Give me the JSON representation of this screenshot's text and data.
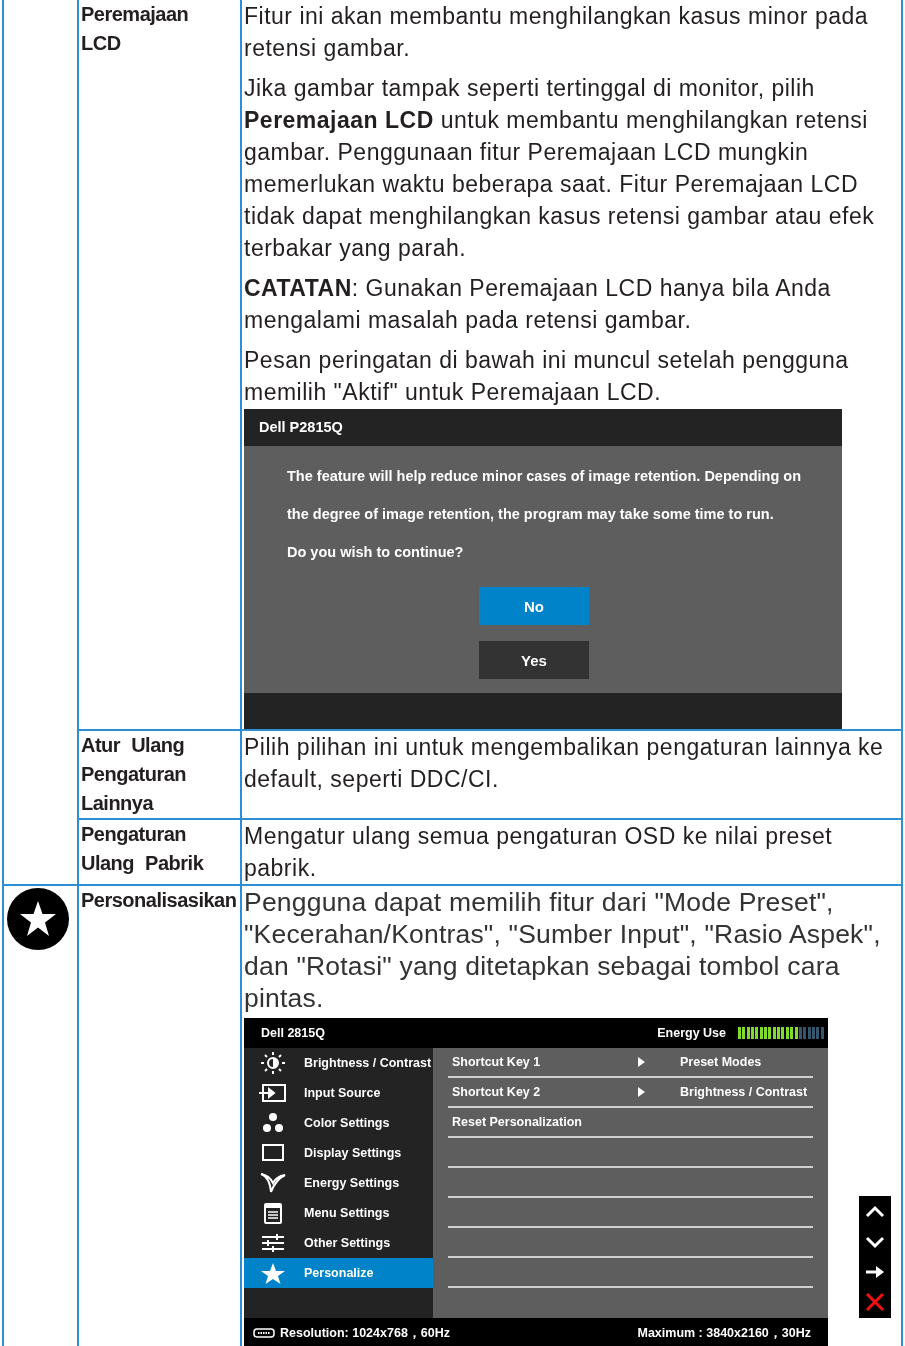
{
  "groups": [
    {
      "kind": "plain",
      "rows": [
        {
          "label": "Peremajaan LCD",
          "content": [
            {
              "kind": "text",
              "text": "Fitur ini akan membantu menghilangkan kasus minor pada retensi gambar."
            },
            {
              "kind": "text",
              "text": "Jika gambar tampak seperti tertinggal di monitor, pilih **Peremajaan LCD** untuk membantu menghilangkan retensi gambar. Penggunaan fitur Peremajaan LCD mungkin memerlukan waktu beberapa saat. Fitur Peremajaan LCD tidak dapat menghilangkan kasus retensi gambar atau efek terbakar yang parah."
            },
            {
              "kind": "text",
              "text": "**CATATAN**: Gunakan Peremajaan LCD hanya bila Anda mengalami masalah pada retensi gambar."
            },
            {
              "kind": "text",
              "text": "Pesan peringatan di bawah ini muncul setelah pengguna memilih \"Aktif\" untuk Peremajaan LCD."
            },
            {
              "kind": "dialog",
              "title": "Dell P2815Q",
              "message_lines": [
                "The feature will help reduce minor cases of image retention. Depending on",
                "the degree of image retention, the program may take some time to run.",
                "Do you wish to continue?"
              ],
              "buttons": [
                {
                  "label": "No",
                  "selected": true
                },
                {
                  "label": "Yes",
                  "selected": false
                }
              ]
            }
          ]
        },
        {
          "label": "Atur Ulang Pengaturan Lainnya",
          "content": [
            {
              "kind": "text",
              "text": "Pilih pilihan ini untuk mengembalikan pengaturan lainnya ke default, seperti DDC/CI."
            }
          ]
        },
        {
          "label": "Pengaturan Ulang Pabrik",
          "content": [
            {
              "kind": "text",
              "text": "Mengatur ulang semua pengaturan OSD ke nilai preset pabrik."
            }
          ]
        }
      ]
    },
    {
      "kind": "starred",
      "rows": [
        {
          "label": "Personalisasikan",
          "content": [
            {
              "kind": "lead",
              "text": "Pengguna dapat memilih fitur dari \"Mode Preset\", \"Kecerahan/Kontras\", \"Sumber Input\", \"Rasio Aspek\", dan \"Rotasi\" yang ditetapkan sebagai tombol cara pintas."
            },
            {
              "kind": "osd",
              "title": "Dell 2815Q",
              "energy": {
                "label": "Energy Use",
                "level": 0.7
              },
              "menu": [
                {
                  "kind": "brightness",
                  "label": "Brightness / Contrast",
                  "selected": false
                },
                {
                  "kind": "input",
                  "label": "Input Source",
                  "selected": false
                },
                {
                  "kind": "color",
                  "label": "Color Settings",
                  "selected": false
                },
                {
                  "kind": "display",
                  "label": "Display Settings",
                  "selected": false
                },
                {
                  "kind": "energy",
                  "label": "Energy Settings",
                  "selected": false
                },
                {
                  "kind": "menu",
                  "label": "Menu Settings",
                  "selected": false
                },
                {
                  "kind": "other",
                  "label": "Other Settings",
                  "selected": false
                },
                {
                  "kind": "personalize",
                  "label": "Personalize",
                  "selected": true
                }
              ],
              "options": [
                {
                  "label": "Shortcut Key 1",
                  "submenu": true,
                  "value": "Preset Modes"
                },
                {
                  "label": "Shortcut Key 2",
                  "submenu": true,
                  "value": "Brightness / Contrast"
                },
                {
                  "label": "Reset Personalization",
                  "submenu": false
                }
              ],
              "resolution": "Resolution: 1024x768，60Hz",
              "maximum": "Maximum : 3840x2160，30Hz",
              "nav_buttons": [
                {
                  "kind": "up"
                },
                {
                  "kind": "down"
                },
                {
                  "kind": "enter"
                },
                {
                  "kind": "exit"
                }
              ]
            }
          ]
        }
      ]
    }
  ]
}
